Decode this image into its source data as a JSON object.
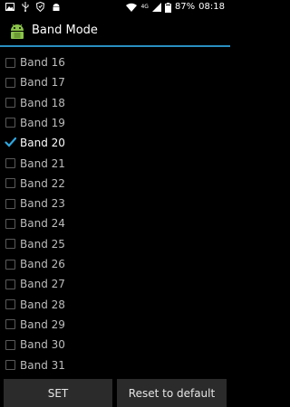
{
  "status_bar": {
    "left_icons": [
      "image-icon",
      "usb-icon",
      "shield-icon",
      "android-icon"
    ],
    "network_label": "4G",
    "battery_percent": "87%",
    "time": "08:18"
  },
  "appbar": {
    "title": "Band Mode",
    "accent_color": "#2a8fc1"
  },
  "bands": [
    {
      "label": "Band 16",
      "checked": false
    },
    {
      "label": "Band 17",
      "checked": false
    },
    {
      "label": "Band 18",
      "checked": false
    },
    {
      "label": "Band 19",
      "checked": false
    },
    {
      "label": "Band 20",
      "checked": true
    },
    {
      "label": "Band 21",
      "checked": false
    },
    {
      "label": "Band 22",
      "checked": false
    },
    {
      "label": "Band 23",
      "checked": false
    },
    {
      "label": "Band 24",
      "checked": false
    },
    {
      "label": "Band 25",
      "checked": false
    },
    {
      "label": "Band 26",
      "checked": false
    },
    {
      "label": "Band 27",
      "checked": false
    },
    {
      "label": "Band 28",
      "checked": false
    },
    {
      "label": "Band 29",
      "checked": false
    },
    {
      "label": "Band 30",
      "checked": false
    },
    {
      "label": "Band 31",
      "checked": false
    }
  ],
  "buttons": {
    "set_label": "SET",
    "reset_label": "Reset to default"
  }
}
